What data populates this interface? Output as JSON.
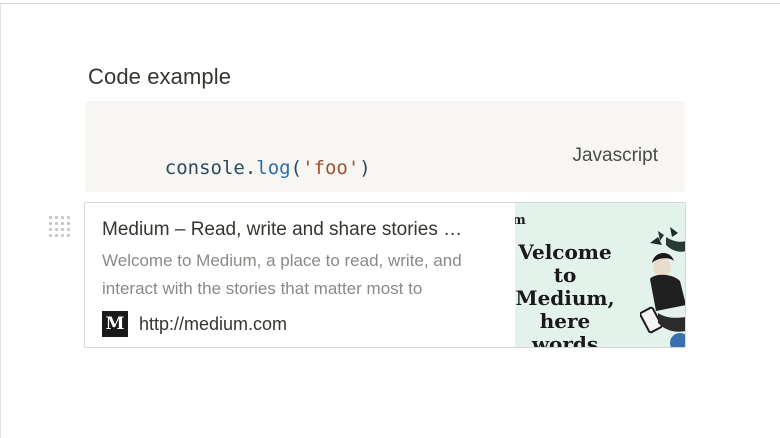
{
  "heading": "Code example",
  "code_block": {
    "tokens": [
      {
        "text": "console",
        "kind": "plain"
      },
      {
        "text": ".",
        "kind": "plain"
      },
      {
        "text": "log",
        "kind": "func"
      },
      {
        "text": "(",
        "kind": "plain"
      },
      {
        "text": "'foo'",
        "kind": "str"
      },
      {
        "text": ")",
        "kind": "plain"
      }
    ],
    "language": "Javascript",
    "background": "#f7f6f3"
  },
  "bookmark": {
    "title": "Medium – Read, write and share stories …",
    "description": "Welcome to Medium, a place to read, write, and interact with the stories that matter most to",
    "favicon_letter": "M",
    "url": "http://medium.com",
    "thumbnail": {
      "corner_text": "m",
      "headline": "Velcome to Medium, here words matter.",
      "background": "#e4f2ec"
    }
  },
  "icons": {
    "drag_handle": "drag-handle-icon",
    "favicon": "medium-logo-icon"
  }
}
